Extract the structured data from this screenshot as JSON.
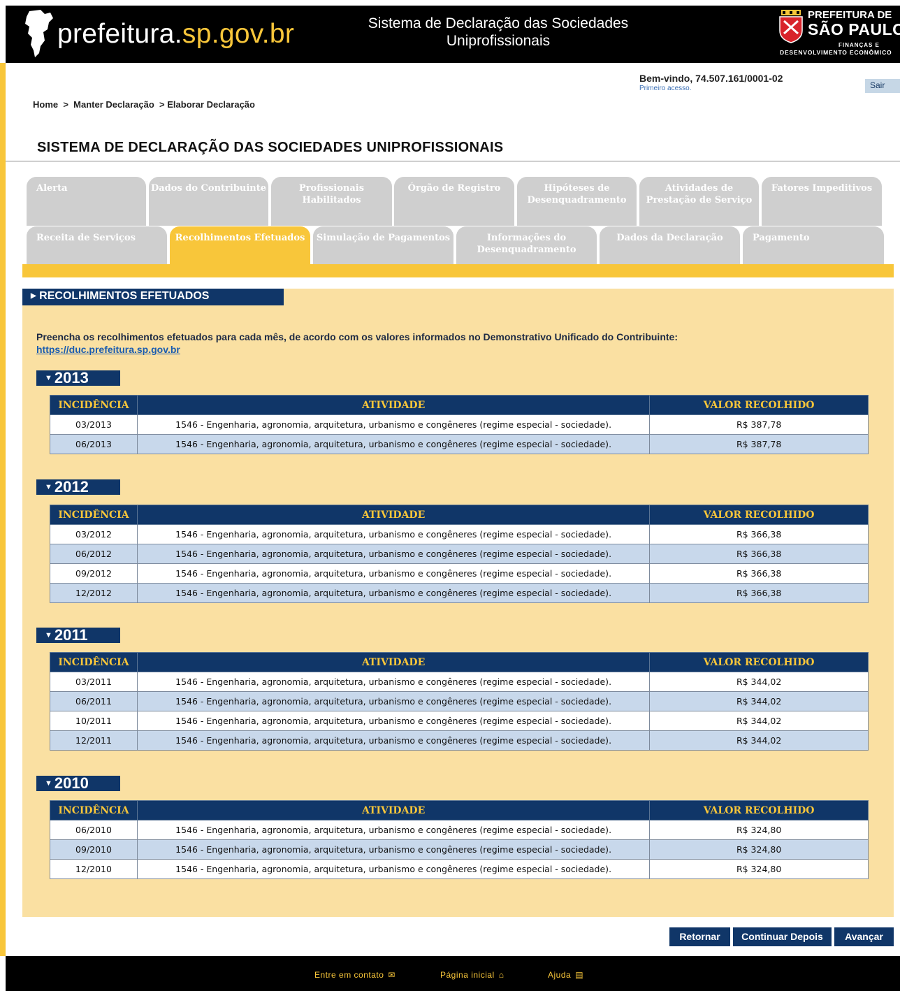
{
  "header": {
    "logo_prefix": "prefeitura.",
    "logo_bold": "sp.gov.br",
    "system_title_line1": "Sistema de Declaração das Sociedades",
    "system_title_line2": "Uniprofissionais",
    "pref_line1": "PREFEITURA DE",
    "pref_line2": "SÃO PAULO",
    "pref_line3": "FINANÇAS E",
    "pref_line4": "DESENVOLVIMENTO ECONÔMICO"
  },
  "user": {
    "welcome": "Bem-vindo, 74.507.161/0001-02",
    "first_access": "Primeiro acesso.",
    "logout_label": "Sair"
  },
  "breadcrumb": {
    "home": "Home",
    "sep1": "  >  ",
    "manter": "Manter Declaração",
    "sep2": "  > ",
    "elaborar": "Elaborar Declaração"
  },
  "page_title": "SISTEMA DE DECLARAÇÃO DAS SOCIEDADES UNIPROFISSIONAIS",
  "tabs_row1": [
    "Alerta",
    "Dados do Contribuinte",
    "Profissionais Habilitados",
    "Órgão de Registro",
    "Hipóteses de Desenquadramento",
    "Atividades de Prestação de Serviço",
    "Fatores Impeditivos"
  ],
  "tabs_row2": [
    "Receita de Serviços",
    "Recolhimentos Efetuados",
    "Simulação de Pagamentos",
    "Informações do Desenquadramento",
    "Dados da Declaração",
    "Pagamento"
  ],
  "active_tab": "Recolhimentos Efetuados",
  "section": {
    "title": "RECOLHIMENTOS EFETUADOS",
    "intro": "Preencha os recolhimentos efetuados para cada mês, de acordo com os valores informados no Demonstrativo Unificado do Contribuinte:",
    "link": "https://duc.prefeitura.sp.gov.br"
  },
  "table_headers": {
    "incidencia": "INCIDÊNCIA",
    "atividade": "ATIVIDADE",
    "valor": "VALOR RECOLHIDO"
  },
  "years": [
    {
      "year": "2013",
      "rows": [
        {
          "incidencia": "03/2013",
          "atividade": "1546 - Engenharia, agronomia, arquitetura, urbanismo e congêneres (regime especial - sociedade).",
          "valor": "R$ 387,78"
        },
        {
          "incidencia": "06/2013",
          "atividade": "1546 - Engenharia, agronomia, arquitetura, urbanismo e congêneres (regime especial - sociedade).",
          "valor": "R$ 387,78"
        }
      ]
    },
    {
      "year": "2012",
      "rows": [
        {
          "incidencia": "03/2012",
          "atividade": "1546 - Engenharia, agronomia, arquitetura, urbanismo e congêneres (regime especial - sociedade).",
          "valor": "R$ 366,38"
        },
        {
          "incidencia": "06/2012",
          "atividade": "1546 - Engenharia, agronomia, arquitetura, urbanismo e congêneres (regime especial - sociedade).",
          "valor": "R$ 366,38"
        },
        {
          "incidencia": "09/2012",
          "atividade": "1546 - Engenharia, agronomia, arquitetura, urbanismo e congêneres (regime especial - sociedade).",
          "valor": "R$ 366,38"
        },
        {
          "incidencia": "12/2012",
          "atividade": "1546 - Engenharia, agronomia, arquitetura, urbanismo e congêneres (regime especial - sociedade).",
          "valor": "R$ 366,38"
        }
      ]
    },
    {
      "year": "2011",
      "rows": [
        {
          "incidencia": "03/2011",
          "atividade": "1546 - Engenharia, agronomia, arquitetura, urbanismo e congêneres (regime especial - sociedade).",
          "valor": "R$ 344,02"
        },
        {
          "incidencia": "06/2011",
          "atividade": "1546 - Engenharia, agronomia, arquitetura, urbanismo e congêneres (regime especial - sociedade).",
          "valor": "R$ 344,02"
        },
        {
          "incidencia": "10/2011",
          "atividade": "1546 - Engenharia, agronomia, arquitetura, urbanismo e congêneres (regime especial - sociedade).",
          "valor": "R$ 344,02"
        },
        {
          "incidencia": "12/2011",
          "atividade": "1546 - Engenharia, agronomia, arquitetura, urbanismo e congêneres (regime especial - sociedade).",
          "valor": "R$ 344,02"
        }
      ]
    },
    {
      "year": "2010",
      "rows": [
        {
          "incidencia": "06/2010",
          "atividade": "1546 - Engenharia, agronomia, arquitetura, urbanismo e congêneres (regime especial - sociedade).",
          "valor": "R$ 324,80"
        },
        {
          "incidencia": "09/2010",
          "atividade": "1546 - Engenharia, agronomia, arquitetura, urbanismo e congêneres (regime especial - sociedade).",
          "valor": "R$ 324,80"
        },
        {
          "incidencia": "12/2010",
          "atividade": "1546 - Engenharia, agronomia, arquitetura, urbanismo e congêneres (regime especial - sociedade).",
          "valor": "R$ 324,80"
        }
      ]
    }
  ],
  "buttons": {
    "retornar": "Retornar",
    "continuar": "Continuar Depois",
    "avancar": "Avançar"
  },
  "footer": {
    "contato": "Entre em contato",
    "inicial": "Página inicial",
    "ajuda": "Ajuda"
  },
  "colors": {
    "brand_yellow": "#f8c63a",
    "navy": "#103668",
    "content_bg": "#fae0a2",
    "row_alt": "#c8d8eb",
    "tab_inactive": "#cfcfcf"
  }
}
